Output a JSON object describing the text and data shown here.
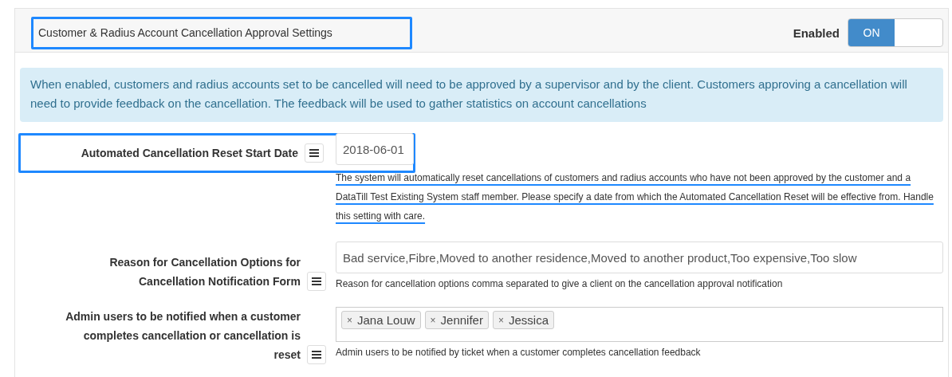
{
  "panel": {
    "title": "Customer & Radius Account Cancellation Approval Settings",
    "title_highlighted": true,
    "toggle": {
      "label": "Enabled",
      "state_text": "ON",
      "on": true
    }
  },
  "info": "When enabled, customers and radius accounts set to be cancelled will need to be approved by a supervisor and by the client. Customers approving a cancellation will need to provide feedback on the cancellation. The feedback will be used to gather statistics on account cancellations",
  "fields": [
    {
      "kind": "date",
      "label": "Automated Cancellation Reset Start Date",
      "value": "2018-06-01",
      "highlighted": true,
      "help": "The system will automatically reset cancellations of customers and radius accounts who have not been approved by the customer and a DataTill Test Existing System staff member. Please specify a date from which the Automated Cancellation Reset will be effective from. Handle this setting with care.",
      "help_underlined": true
    },
    {
      "kind": "text",
      "label": "Reason for Cancellation Options for Cancellation Notification Form",
      "value": "Bad service,Fibre,Moved to another residence,Moved to another product,Too expensive,Too slow",
      "highlighted": false,
      "help": "Reason for cancellation options comma separated to give a client on the cancellation approval notification",
      "help_underlined": false
    },
    {
      "kind": "tags",
      "label": "Admin users to be notified when a customer completes cancellation or cancellation is reset",
      "tags": [
        {
          "remove": "×",
          "name": "Jana Louw"
        },
        {
          "remove": "×",
          "name": "Jennifer"
        },
        {
          "remove": "×",
          "name": "Jessica"
        }
      ],
      "highlighted": false,
      "help": "Admin users to be notified by ticket when a customer completes cancellation feedback",
      "help_underlined": false
    }
  ]
}
